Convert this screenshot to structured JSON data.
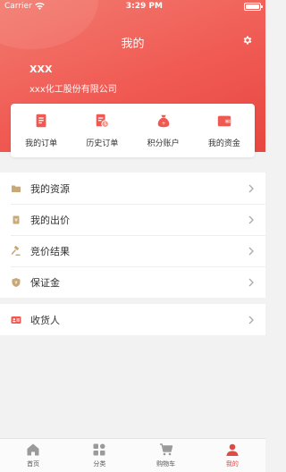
{
  "status_bar": {
    "carrier": "Carrier",
    "time": "3:29 PM"
  },
  "header": {
    "title": "我的",
    "user_name": "XXX",
    "company": "xxx化工股份有限公司"
  },
  "quick_actions": [
    {
      "label": "我的订单",
      "icon": "order-icon"
    },
    {
      "label": "历史订单",
      "icon": "history-order-icon"
    },
    {
      "label": "积分账户",
      "icon": "points-bag-icon"
    },
    {
      "label": "我的资金",
      "icon": "wallet-icon"
    }
  ],
  "menu": {
    "group1": [
      {
        "label": "我的资源",
        "icon": "folder-icon"
      },
      {
        "label": "我的出价",
        "icon": "bid-icon"
      },
      {
        "label": "竞价结果",
        "icon": "gavel-icon"
      },
      {
        "label": "保证金",
        "icon": "shield-icon"
      }
    ],
    "group2": [
      {
        "label": "收货人",
        "icon": "id-card-icon"
      }
    ]
  },
  "tabs": [
    {
      "label": "首页",
      "icon": "home-icon"
    },
    {
      "label": "分类",
      "icon": "category-icon"
    },
    {
      "label": "购物车",
      "icon": "cart-icon"
    },
    {
      "label": "我的",
      "icon": "user-icon",
      "active": true
    }
  ],
  "colors": {
    "brand": "#f05a53",
    "accent_active": "#e04a44",
    "icon_gold": "#c9a878"
  }
}
